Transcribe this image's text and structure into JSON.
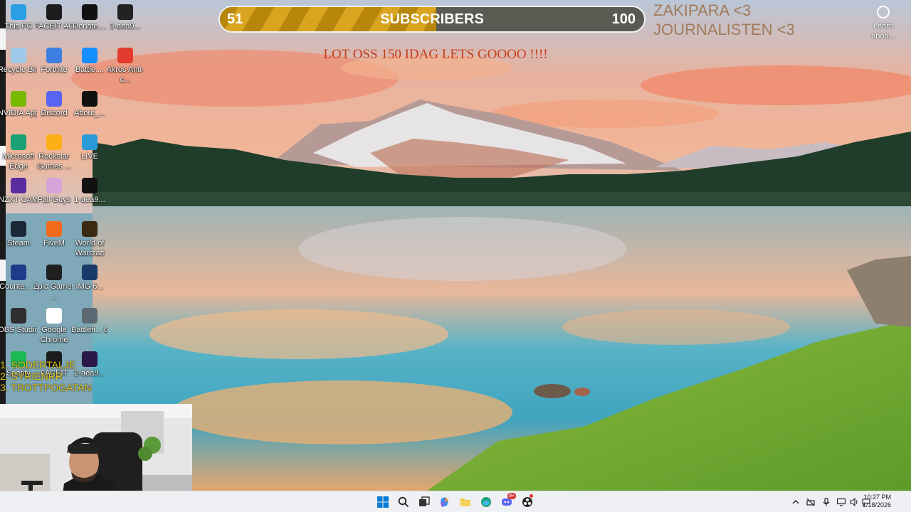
{
  "desktop_icons": [
    {
      "name": "this-pc",
      "label": "This PC",
      "icon": "monitor-icon",
      "bg": "#2b9fe3",
      "col": 0,
      "row": 0
    },
    {
      "name": "faceit-ac",
      "label": "FACEIT AC",
      "icon": "faceit-shield-icon",
      "bg": "#1c1c1c",
      "col": 1,
      "row": 0
    },
    {
      "name": "donate",
      "label": "Donate....",
      "icon": "donate-image-icon",
      "bg": "#111111",
      "col": 2,
      "row": 0
    },
    {
      "name": "aea9-3",
      "label": "3-aea9...",
      "icon": "image-file-icon",
      "bg": "#222222",
      "col": 3,
      "row": 0
    },
    {
      "name": "recycle-bin",
      "label": "Recycle Bin",
      "icon": "recycle-bin-icon",
      "bg": "#9fc9e8",
      "col": 0,
      "row": 1
    },
    {
      "name": "fortnite",
      "label": "Fortnite",
      "icon": "fortnite-icon",
      "bg": "#3d7fe0",
      "col": 1,
      "row": 1
    },
    {
      "name": "battlenet",
      "label": "Battle....",
      "icon": "battlenet-icon",
      "bg": "#148eff",
      "col": 2,
      "row": 1
    },
    {
      "name": "akros",
      "label": "Akros Anti-c...",
      "icon": "akros-icon",
      "bg": "#e33b2e",
      "col": 3,
      "row": 1
    },
    {
      "name": "nvidia-app",
      "label": "NVIDIA App",
      "icon": "nvidia-icon",
      "bg": "#76b900",
      "col": 0,
      "row": 2
    },
    {
      "name": "discord",
      "label": "Discord",
      "icon": "discord-icon",
      "bg": "#5865f2",
      "col": 1,
      "row": 2
    },
    {
      "name": "about",
      "label": "About_...",
      "icon": "about-image-icon",
      "bg": "#111111",
      "col": 2,
      "row": 2
    },
    {
      "name": "edge",
      "label": "Microsoft Edge",
      "icon": "edge-icon",
      "bg": "#1aa176",
      "col": 0,
      "row": 3
    },
    {
      "name": "rockstar",
      "label": "Rockstar Games ...",
      "icon": "rockstar-icon",
      "bg": "#fcaf17",
      "col": 1,
      "row": 3
    },
    {
      "name": "live",
      "label": "LIVE",
      "icon": "edge-shortcut-icon",
      "bg": "#2a9ad9",
      "col": 2,
      "row": 3
    },
    {
      "name": "nzxt-cam",
      "label": "NZXT CAM",
      "icon": "nzxt-icon",
      "bg": "#5a2ca0",
      "col": 0,
      "row": 4
    },
    {
      "name": "fall-guys",
      "label": "Fall Guys",
      "icon": "fall-guys-icon",
      "bg": "#d8a3d9",
      "col": 1,
      "row": 4
    },
    {
      "name": "aea9-1",
      "label": "1-aea9...",
      "icon": "image-file-icon",
      "bg": "#111111",
      "col": 2,
      "row": 4
    },
    {
      "name": "steam",
      "label": "Steam",
      "icon": "steam-icon",
      "bg": "#1b2838",
      "col": 0,
      "row": 5
    },
    {
      "name": "fivem",
      "label": "FiveM",
      "icon": "fivem-icon",
      "bg": "#f26b1d",
      "col": 1,
      "row": 5
    },
    {
      "name": "wow",
      "label": "World of Warcraft",
      "icon": "wow-icon",
      "bg": "#3a2a10",
      "col": 2,
      "row": 5
    },
    {
      "name": "counter-strike",
      "label": "Counte... 2",
      "icon": "cs2-icon",
      "bg": "#1e3c8c",
      "col": 0,
      "row": 6
    },
    {
      "name": "epic",
      "label": "Epic Games ...",
      "icon": "epic-icon",
      "bg": "#202020",
      "col": 1,
      "row": 6
    },
    {
      "name": "img6",
      "label": "IMG 6...",
      "icon": "image-file-icon",
      "bg": "#1a3a6a",
      "col": 2,
      "row": 6
    },
    {
      "name": "obs",
      "label": "OBS Studio",
      "icon": "obs-icon",
      "bg": "#302e31",
      "col": 0,
      "row": 7
    },
    {
      "name": "chrome",
      "label": "Google Chrome",
      "icon": "chrome-icon",
      "bg": "#ffffff",
      "col": 1,
      "row": 7
    },
    {
      "name": "battlefield",
      "label": "Battlefi... 6",
      "icon": "battlefield-icon",
      "bg": "#5b6a72",
      "col": 2,
      "row": 7
    },
    {
      "name": "spotify",
      "label": "Spotify",
      "icon": "spotify-icon",
      "bg": "#1db954",
      "col": 0,
      "row": 8
    },
    {
      "name": "faceit",
      "label": "FACEIT",
      "icon": "faceit-icon",
      "bg": "#1c1c1c",
      "col": 1,
      "row": 8
    },
    {
      "name": "aea9-2",
      "label": "2-aea9...",
      "icon": "image-file-icon",
      "bg": "#2a1a4a",
      "col": 2,
      "row": 8
    }
  ],
  "subscriber_goal": {
    "current": "51",
    "label": "SUBSCRIBERS",
    "goal": "100",
    "progress_fraction": 0.51,
    "fill_color": "#c8961a"
  },
  "shoutouts": [
    "ZAKIPARA <3",
    "JOURNALISTEN <3"
  ],
  "banner": "LOT OSS 150 IDAG LETS GOOOO !!!!",
  "learn_about": "Learn abou...",
  "top_list": [
    {
      "rank": "1.",
      "name": "SODERTALJE"
    },
    {
      "rank": "2.",
      "name": "SYRIENRR"
    },
    {
      "rank": "3.",
      "name": "TROTTPOGATAN"
    }
  ],
  "taskbar": {
    "pinned": [
      "windows-start-icon",
      "search-icon",
      "task-view-icon",
      "copilot-icon",
      "file-explorer-icon",
      "edge-icon",
      "discord-icon",
      "obs-icon"
    ],
    "discord_badge": "9+",
    "tray": [
      "chevron-up-icon",
      "network-off-icon",
      "microphone-icon",
      "display-icon",
      "speaker-icon",
      "chat-icon"
    ],
    "time": "10:27 PM",
    "date": "1/18/2026"
  },
  "colors": {
    "taskbar": "#eef0f3",
    "accent": "#0067c0"
  }
}
